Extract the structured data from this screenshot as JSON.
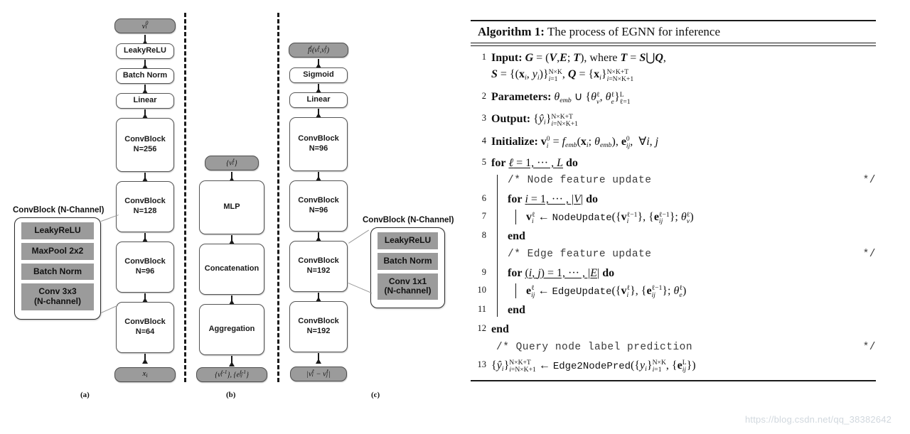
{
  "figure": {
    "panels": [
      {
        "id": "a",
        "caption": "(a)",
        "output_label": "v_i^0",
        "nodes": [
          {
            "label": "LeakyReLU"
          },
          {
            "label": "Batch Norm"
          },
          {
            "label": "Linear"
          },
          {
            "label": "ConvBlock",
            "sublabel": "N=256"
          },
          {
            "label": "ConvBlock",
            "sublabel": "N=128"
          },
          {
            "label": "ConvBlock",
            "sublabel": "N=96"
          },
          {
            "label": "ConvBlock",
            "sublabel": "N=64"
          }
        ],
        "input_label": "x_i",
        "callout": {
          "title": "ConvBlock (N-Channel)",
          "rows": [
            "LeakyReLU",
            "MaxPool 2x2",
            "Batch Norm",
            "Conv 3x3\n(N-channel)"
          ]
        }
      },
      {
        "id": "b",
        "caption": "(b)",
        "output_label": "{v_i^l}",
        "nodes": [
          {
            "label": "MLP"
          },
          {
            "label": "Concatenation"
          },
          {
            "label": "Aggregation"
          }
        ],
        "input_label": "{v_i^{l-1}}, {e_ij^{l-1}}"
      },
      {
        "id": "c",
        "caption": "(c)",
        "output_label": "f_e^l(v_i^l, v_j^l)",
        "nodes": [
          {
            "label": "Sigmoid"
          },
          {
            "label": "Linear"
          },
          {
            "label": "ConvBlock",
            "sublabel": "N=96"
          },
          {
            "label": "ConvBlock",
            "sublabel": "N=96"
          },
          {
            "label": "ConvBlock",
            "sublabel": "N=192"
          },
          {
            "label": "ConvBlock",
            "sublabel": "N=192"
          }
        ],
        "input_label": "|v_i^l - v_j^l|",
        "callout": {
          "title": "ConvBlock (N-Channel)",
          "rows": [
            "LeakyReLU",
            "Batch Norm",
            "Conv 1x1\n(N-channel)"
          ]
        }
      }
    ]
  },
  "algorithm": {
    "number": "Algorithm 1:",
    "title": "The process of EGNN for inference",
    "lines": [
      {
        "num": "1",
        "kind": "stmt",
        "text": "Input: G = (V, E; T), where T = S ⋃ Q,"
      },
      {
        "num": "",
        "kind": "cont",
        "text": "S = {(x_i, y_i)}_{i=1}^{N×K}, Q = {x_i}_{i=N×K+1}^{N×K+T}"
      },
      {
        "num": "2",
        "kind": "stmt",
        "text": "Parameters: θ_emb ∪ {θ_v^l, θ_e^l}_{l=1}^{L}"
      },
      {
        "num": "3",
        "kind": "stmt",
        "text": "Output: {ŷ_i}_{i=N×K+1}^{N×K+T}"
      },
      {
        "num": "4",
        "kind": "stmt",
        "text": "Initialize: v_i^0 = f_emb(x_i; θ_emb), e_ij^0, ∀i, j"
      },
      {
        "num": "5",
        "kind": "for",
        "text": "for ℓ = 1, ··· , L do"
      },
      {
        "num": "",
        "kind": "comment",
        "text": "/* Node feature update",
        "close": "*/"
      },
      {
        "num": "6",
        "kind": "for",
        "text": "for i = 1, ··· , |V| do"
      },
      {
        "num": "7",
        "kind": "stmt",
        "text": "v_i^ℓ ← NodeUpdate({v_i^{ℓ-1}}, {e_ij^{ℓ-1}}; θ_v^ℓ)"
      },
      {
        "num": "8",
        "kind": "end",
        "text": "end"
      },
      {
        "num": "",
        "kind": "comment",
        "text": "/* Edge feature update",
        "close": "*/"
      },
      {
        "num": "9",
        "kind": "for",
        "text": "for (i, j) = 1, ··· , |E| do"
      },
      {
        "num": "10",
        "kind": "stmt",
        "text": "e_ij^ℓ ← EdgeUpdate({v_i^ℓ}, {e_ij^{ℓ-1}}; θ_e^ℓ)"
      },
      {
        "num": "11",
        "kind": "end",
        "text": "end"
      },
      {
        "num": "12",
        "kind": "end",
        "text": "end"
      },
      {
        "num": "",
        "kind": "comment",
        "text": "/* Query node label prediction",
        "close": "*/"
      },
      {
        "num": "13",
        "kind": "stmt",
        "text": "{ŷ_i}_{i=N×K+1}^{N×K+T} ← Edge2NodePred({y_i}_{i=1}^{N×K}, {e_ij^L})"
      }
    ]
  },
  "watermark": "https://blog.csdn.net/qq_38382642",
  "colors": {
    "io_box_fill": "#9b9b9b",
    "callout_row_fill": "#9b9b9b",
    "node_border": "#555555",
    "line": "#1a1a1a"
  }
}
